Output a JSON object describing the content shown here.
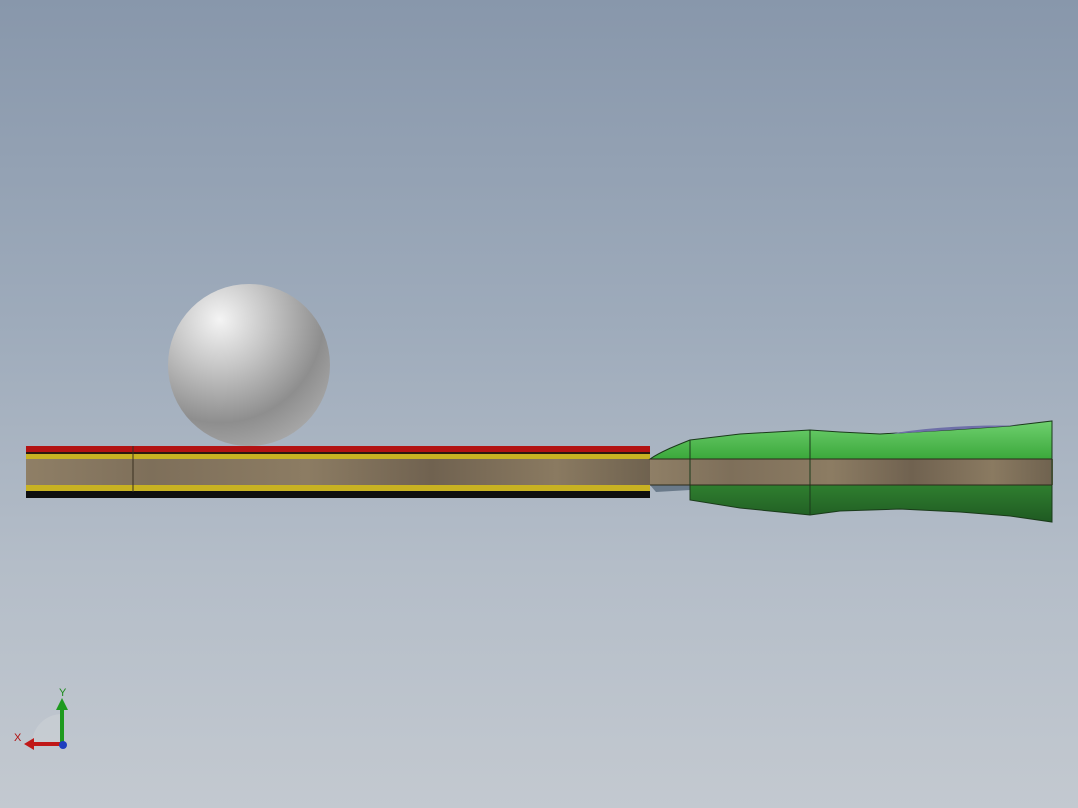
{
  "viewport": {
    "background_top": "#8897ab",
    "background_bottom": "#c3c9d0"
  },
  "scene": {
    "objects": [
      {
        "name": "ball",
        "icon": "sphere",
        "color": "#9a9a9a"
      },
      {
        "name": "paddle-blade",
        "icon": "layered-board",
        "layers": [
          "#b01010",
          "#c9b21f",
          "#8a7a60",
          "#c9b21f",
          "#101010"
        ]
      },
      {
        "name": "paddle-handle",
        "icon": "handle",
        "color": "#3fae3f"
      }
    ]
  },
  "triad": {
    "x_label": "X",
    "y_label": "Y",
    "x_color": "#c01818",
    "y_color": "#1e9a1e",
    "z_color": "#1f3fbf"
  }
}
